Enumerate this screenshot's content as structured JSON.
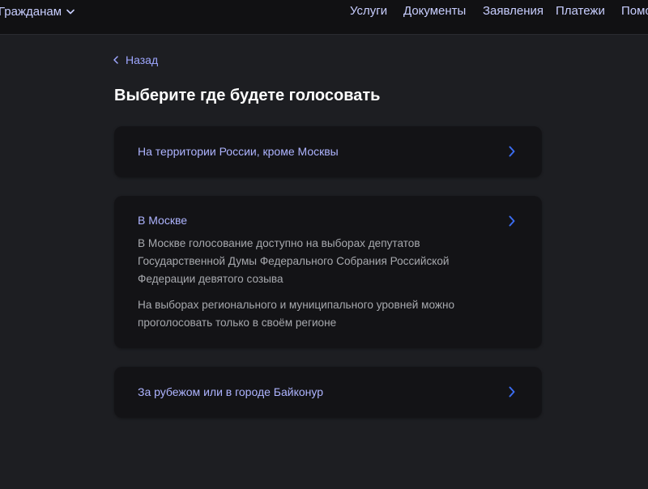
{
  "header": {
    "audience_label": "Гражданам",
    "nav": [
      "Услуги",
      "Документы",
      "Заявления",
      "Платежи",
      "Помощь"
    ]
  },
  "back_label": "Назад",
  "page_title": "Выберите где будете голосовать",
  "options": [
    {
      "label": "На территории России, кроме Москвы"
    },
    {
      "label": "В Москве",
      "description_1": "В Москве голосование доступно на выборах депутатов Государственной Думы Федерального Собрания Российской Федерации девятого созыва",
      "description_2": "На выборах регионального и муниципального уровней можно проголосовать только в своём регионе"
    },
    {
      "label": "За рубежом или в городе Байконур"
    }
  ],
  "colors": {
    "background": "#1d1e22",
    "card": "#131316",
    "accent": "#aeb4ff",
    "chevron": "#3b6cf0"
  }
}
